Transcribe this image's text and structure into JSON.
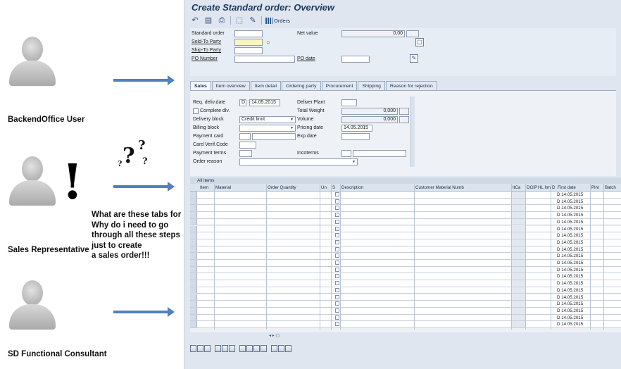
{
  "personas": [
    {
      "label": "BackendOffice User"
    },
    {
      "label": "Sales Representative"
    },
    {
      "label": "SD Functional Consultant"
    }
  ],
  "thought": {
    "lines": [
      "What are these tabs for ?",
      "Why do i need to go",
      "through all these steps",
      "just to create",
      "a sales order!!!"
    ],
    "marks": "?",
    "exclaim": "!"
  },
  "sap": {
    "title": "Create Standard order: Overview",
    "toolbar": {
      "orders_label": "Orders"
    },
    "header": {
      "standard_order": "Standard order",
      "net_value_label": "Net value",
      "net_value": "0,00",
      "sold_to": "Sold-To Party",
      "ship_to": "Ship-To Party",
      "po_number": "PO Number",
      "po_date": "PO date"
    },
    "tabs": [
      "Sales",
      "Item overview",
      "Item detail",
      "Ordering party",
      "Procurement",
      "Shipping",
      "Reason for rejection"
    ],
    "sales": {
      "req_deliv_date": "Req. deliv.date",
      "date_prefix": "D",
      "req_date": "14.05.2015",
      "deliver_plant": "Deliver.Plant",
      "complete_dlv": "Complete dlv.",
      "total_weight": "Total Weight",
      "weight_val": "0,000",
      "delivery_block": "Delivery block",
      "delivery_block_val": "Credit limit",
      "volume": "Volume",
      "volume_val": "0,000",
      "billing_block": "Billing block",
      "pricing_date": "Pricing date",
      "pricing_date_val": "14.05.2015",
      "payment_card": "Payment card",
      "exp_date": "Exp.date",
      "card_verif": "Card Verif.Code",
      "payment_terms": "Payment terms",
      "incoterms": "Incoterms",
      "order_reason": "Order reason"
    },
    "table": {
      "caption": "All items",
      "columns": [
        "Item",
        "Material",
        "Order Quantity",
        "Un",
        "S",
        "Description",
        "Customer Material Numb",
        "ItCa",
        "DGIP",
        "HL Itm",
        "D",
        "First date",
        "Plnt",
        "Batch"
      ],
      "row_prefix": "D",
      "row_dates": [
        "14.05.2015",
        "14.05.2015",
        "14.05.2015",
        "14.05.2015",
        "14.05.2015",
        "14.05.2015",
        "14.05.2015",
        "14.05.2015",
        "14.05.2015",
        "14.05.2015",
        "14.05.2015",
        "14.05.2015",
        "14.05.2015",
        "14.05.2015",
        "14.05.2015",
        "14.05.2015",
        "14.05.2015",
        "14.05.2015",
        "14.05.2015",
        "14.05.2015"
      ]
    }
  },
  "colors": {
    "arrow": "#4f81bd",
    "sap_bg": "#dfe6ef",
    "title": "#1b3a63",
    "required_field": "#fff4c0"
  }
}
